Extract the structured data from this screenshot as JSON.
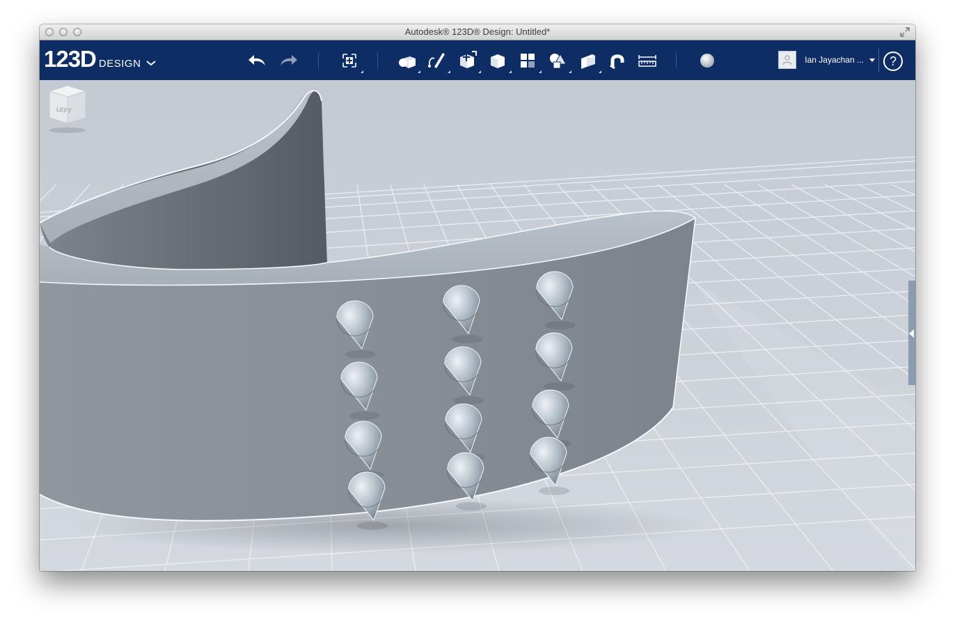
{
  "window": {
    "title": "Autodesk® 123D® Design: Untitled*"
  },
  "logo": {
    "main": "123D",
    "sub": "DESIGN"
  },
  "toolbar": {
    "tools": [
      {
        "name": "undo-icon"
      },
      {
        "name": "redo-icon"
      },
      {
        "name": "transform-icon"
      },
      {
        "name": "primitives-icon"
      },
      {
        "name": "sketch-icon"
      },
      {
        "name": "construct-icon"
      },
      {
        "name": "modify-icon"
      },
      {
        "name": "pattern-icon"
      },
      {
        "name": "grouping-icon"
      },
      {
        "name": "combine-icon"
      },
      {
        "name": "snap-icon"
      },
      {
        "name": "measure-icon"
      },
      {
        "name": "material-icon"
      }
    ]
  },
  "user": {
    "name": "Ian Jayachan ..."
  },
  "help": {
    "label": "?"
  },
  "viewcube": {
    "face_label": "LEFT"
  },
  "colors": {
    "toolbar": "#0d2d64",
    "viewport": "#cdd3da",
    "model": "#8d949c"
  }
}
